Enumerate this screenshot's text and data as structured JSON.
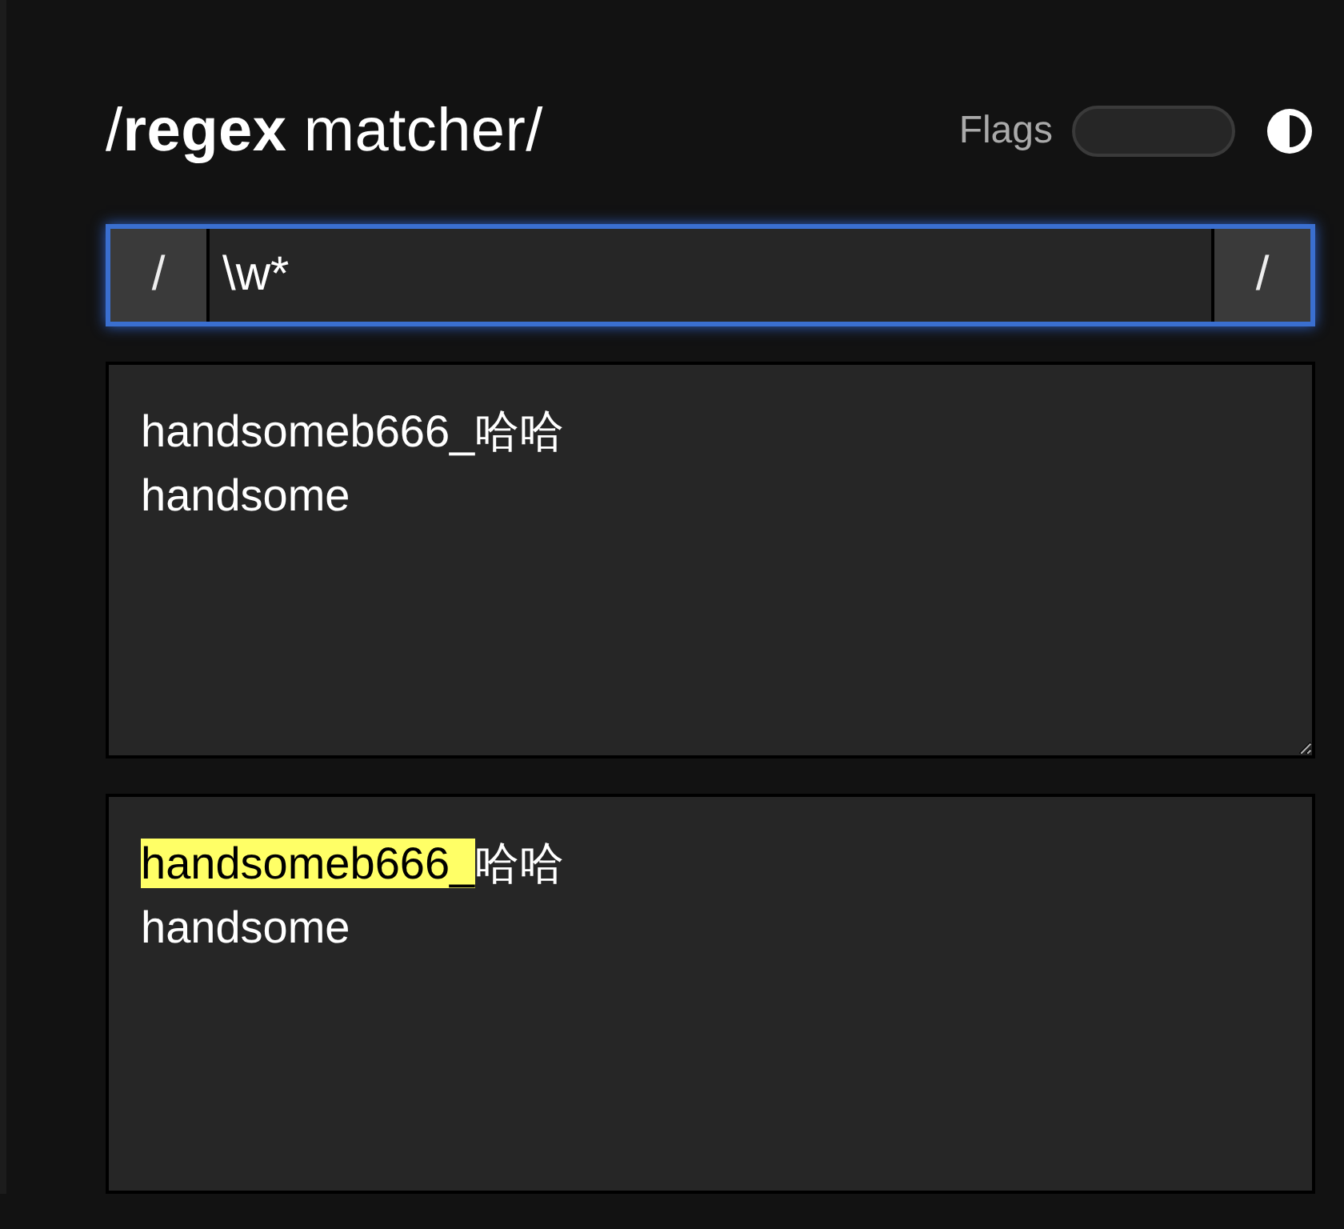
{
  "header": {
    "title": "/**regex** matcher/",
    "flags_label": "Flags",
    "flags_on": false
  },
  "pattern": {
    "open": "/",
    "value": "\\w*",
    "close": "/",
    "focused": true
  },
  "test_text": "handsomeb666_哈哈\nhandsome",
  "result": {
    "lines": [
      [
        {
          "text": "handsomeb666_",
          "match": true
        },
        {
          "text": "哈哈",
          "match": false
        }
      ],
      [
        {
          "text": "handsome",
          "match": false
        }
      ]
    ]
  }
}
